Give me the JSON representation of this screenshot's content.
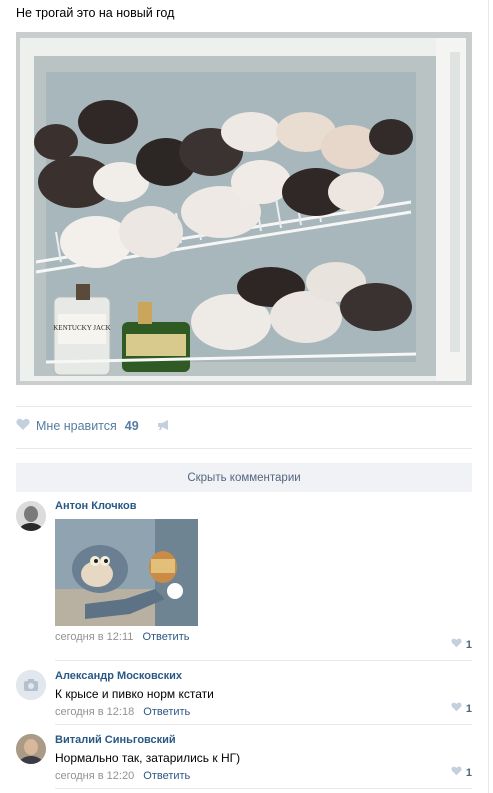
{
  "post": {
    "text": "Не трогай это на новый год",
    "like_label": "Мне нравится",
    "like_count": "49",
    "icons": [
      "heart-icon",
      "megaphone-icon"
    ]
  },
  "comments_toggle": "Скрыть комментарии",
  "comments": [
    {
      "author": "Антон Клочков",
      "text": "",
      "time": "сегодня в 12:11",
      "reply": "Ответить",
      "likes": "1"
    },
    {
      "author": "Александр Московских",
      "text": "К крысе и пивко норм кстати",
      "time": "сегодня в 12:18",
      "reply": "Ответить",
      "likes": "1"
    },
    {
      "author": "Виталий Синьговский",
      "text": "Нормально так, затарились к НГ)",
      "time": "сегодня в 12:20",
      "reply": "Ответить",
      "likes": "1"
    }
  ],
  "colors": {
    "link": "#2a5885",
    "button_bg": "#f0f2f5",
    "divider": "#e7e8ec"
  },
  "images": {
    "photo": "Refrigerator shelves filled with rats, bottles below",
    "comment_image": "Cartoon cat and mouse holding a sandwich"
  },
  "brand_text": {
    "bottle_label": "KENTUCKY JACK"
  }
}
